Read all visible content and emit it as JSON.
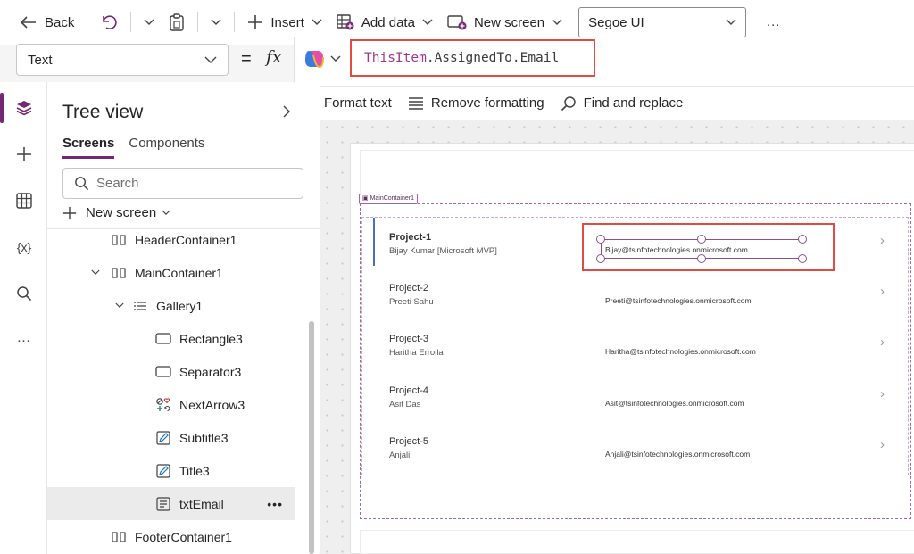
{
  "toolbar": {
    "back": "Back",
    "insert": "Insert",
    "add_data": "Add data",
    "new_screen": "New screen",
    "font": "Segoe UI",
    "more": "…"
  },
  "formula": {
    "property": "Text",
    "equals": "=",
    "fx": "fx",
    "keyword": "ThisItem",
    "rest": ".AssignedTo.Email"
  },
  "format_bar": {
    "format_text": "Format text",
    "remove_formatting": "Remove formatting",
    "find_replace": "Find and replace"
  },
  "rail": {
    "variables": "{x}",
    "more": "…"
  },
  "tree": {
    "title": "Tree view",
    "tabs": [
      "Screens",
      "Components"
    ],
    "search_placeholder": "Search",
    "new_screen": "New screen",
    "nodes": [
      {
        "label": "HeaderContainer1",
        "icon": "container-icon"
      },
      {
        "label": "MainContainer1",
        "icon": "container-icon",
        "expanded": true
      },
      {
        "label": "Gallery1",
        "icon": "gallery-icon",
        "expanded": true
      },
      {
        "label": "Rectangle3",
        "icon": "rectangle-icon"
      },
      {
        "label": "Separator3",
        "icon": "rectangle-icon"
      },
      {
        "label": "NextArrow3",
        "icon": "icons-icon"
      },
      {
        "label": "Subtitle3",
        "icon": "label-edit-icon"
      },
      {
        "label": "Title3",
        "icon": "label-edit-icon"
      },
      {
        "label": "txtEmail",
        "icon": "text-label-icon",
        "selected": true
      },
      {
        "label": "FooterContainer1",
        "icon": "container-icon"
      }
    ]
  },
  "canvas": {
    "container_tag": "MainContainer1",
    "rows": [
      {
        "title": "Project-1",
        "subtitle": "Bijay Kumar [Microsoft MVP]",
        "email": "Bijay@tsinfotechnologies.onmicrosoft.com"
      },
      {
        "title": "Project-2",
        "subtitle": "Preeti Sahu",
        "email": "Preeti@tsinfotechnologies.onmicrosoft.com"
      },
      {
        "title": "Project-3",
        "subtitle": "Haritha Errolla",
        "email": "Haritha@tsinfotechnologies.onmicrosoft.com"
      },
      {
        "title": "Project-4",
        "subtitle": "Asit Das",
        "email": "Asit@tsinfotechnologies.onmicrosoft.com"
      },
      {
        "title": "Project-5",
        "subtitle": "Anjali",
        "email": "Anjali@tsinfotechnologies.onmicrosoft.com"
      }
    ],
    "arrow": "›"
  },
  "colors": {
    "accent": "#742774",
    "highlight": "#e04c41",
    "selection": "#8f4f8f",
    "row_marker": "#4b6cc6"
  }
}
